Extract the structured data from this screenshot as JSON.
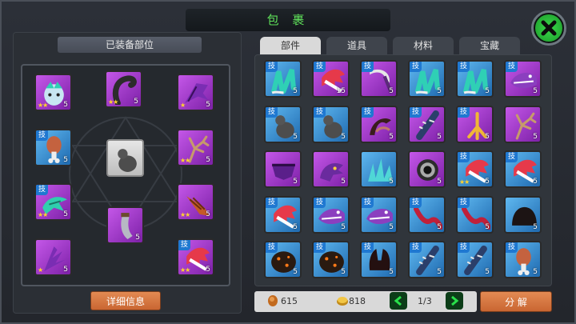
{
  "window": {
    "title": "包 裹"
  },
  "left": {
    "header": "已装备部位",
    "detail_button": "详细信息"
  },
  "tabs": [
    {
      "label": "部件",
      "active": true
    },
    {
      "label": "道具",
      "active": false
    },
    {
      "label": "材料",
      "active": false
    },
    {
      "label": "宝藏",
      "active": false
    }
  ],
  "equipped": [
    {
      "icon": "beast-head-icon",
      "color": "purple",
      "stars": 2,
      "count": "5",
      "tag": ""
    },
    {
      "icon": "scorpion-tail-icon",
      "color": "purple",
      "stars": 2,
      "count": "5",
      "tag": ""
    },
    {
      "icon": "bat-wing-icon",
      "color": "purple",
      "stars": 1,
      "count": "5",
      "tag": ""
    },
    {
      "icon": "meat-leg-icon",
      "color": "blue",
      "stars": 0,
      "count": "5",
      "tag": "技"
    },
    {
      "icon": "gourd-icon",
      "color": "gray",
      "stars": 0,
      "count": "",
      "tag": ""
    },
    {
      "icon": "antler-icon",
      "color": "purple",
      "stars": 2,
      "count": "5",
      "tag": ""
    },
    {
      "icon": "fish-fin-icon",
      "color": "purple",
      "stars": 2,
      "count": "5",
      "tag": "技"
    },
    {
      "icon": "drill-horn-icon",
      "color": "purple",
      "stars": 2,
      "count": "5",
      "tag": ""
    },
    {
      "icon": "curved-blade-icon",
      "color": "purple",
      "stars": 0,
      "count": "5",
      "tag": ""
    },
    {
      "icon": "feather-wing-icon",
      "color": "purple",
      "stars": 1,
      "count": "5",
      "tag": ""
    },
    {
      "icon": "red-claw-icon",
      "color": "purple",
      "stars": 2,
      "count": "5",
      "tag": "技"
    }
  ],
  "grid": [
    {
      "icon": "green-claws-icon",
      "color": "blue",
      "tag": "技",
      "count": "5",
      "stars": 0
    },
    {
      "icon": "red-claw-icon",
      "color": "purple",
      "tag": "技",
      "count": "15",
      "stars": 0
    },
    {
      "icon": "scythe-icon",
      "color": "purple",
      "tag": "技",
      "count": "5",
      "stars": 0
    },
    {
      "icon": "green-claws-icon",
      "color": "blue",
      "tag": "技",
      "count": "5",
      "stars": 0
    },
    {
      "icon": "green-claws-icon",
      "color": "blue",
      "tag": "技",
      "count": "5",
      "stars": 0
    },
    {
      "icon": "shark-head-icon",
      "color": "purple",
      "tag": "技",
      "count": "5",
      "stars": 0
    },
    {
      "icon": "gourd-icon",
      "color": "blue",
      "tag": "技",
      "count": "5",
      "stars": 0
    },
    {
      "icon": "gourd-icon",
      "color": "blue",
      "tag": "技",
      "count": "5",
      "stars": 0
    },
    {
      "icon": "pincer-icon",
      "color": "purple",
      "tag": "技",
      "count": "5",
      "stars": 0
    },
    {
      "icon": "spiked-club-icon",
      "color": "purple",
      "tag": "技",
      "count": "5",
      "stars": 0
    },
    {
      "icon": "bird-foot-icon",
      "color": "purple",
      "tag": "技",
      "count": "5",
      "stars": 0
    },
    {
      "icon": "antler-icon",
      "color": "purple",
      "tag": "",
      "count": "5",
      "stars": 0
    },
    {
      "icon": "armor-plate-icon",
      "color": "purple",
      "tag": "",
      "count": "5",
      "stars": 0
    },
    {
      "icon": "dragon-head-icon",
      "color": "purple",
      "tag": "",
      "count": "5",
      "stars": 0
    },
    {
      "icon": "ice-crystal-icon",
      "color": "blue",
      "tag": "",
      "count": "5",
      "stars": 0
    },
    {
      "icon": "eye-icon",
      "color": "purple",
      "tag": "",
      "count": "5",
      "stars": 0
    },
    {
      "icon": "red-claw-icon",
      "color": "blue",
      "tag": "技",
      "count": "5",
      "stars": 2
    },
    {
      "icon": "red-claw-icon",
      "color": "blue",
      "tag": "技",
      "count": "5",
      "stars": 0
    },
    {
      "icon": "red-claw-icon",
      "color": "blue",
      "tag": "技",
      "count": "5",
      "stars": 0
    },
    {
      "icon": "shark-head-icon",
      "color": "blue",
      "tag": "技",
      "count": "5",
      "stars": 0
    },
    {
      "icon": "shark-head-icon",
      "color": "blue",
      "tag": "技",
      "count": "5",
      "stars": 0
    },
    {
      "icon": "red-tail-icon",
      "color": "blue",
      "tag": "技",
      "count": "5",
      "stars": 0
    },
    {
      "icon": "red-tail-icon",
      "color": "blue",
      "tag": "技",
      "count": "5",
      "stars": 0
    },
    {
      "icon": "dark-blob-icon",
      "color": "blue",
      "tag": "",
      "count": "5",
      "stars": 0
    },
    {
      "icon": "lava-rock-icon",
      "color": "blue",
      "tag": "技",
      "count": "5",
      "stars": 0
    },
    {
      "icon": "lava-rock-icon",
      "color": "blue",
      "tag": "技",
      "count": "5",
      "stars": 0
    },
    {
      "icon": "dark-horns-icon",
      "color": "blue",
      "tag": "技",
      "count": "5",
      "stars": 0
    },
    {
      "icon": "spiked-club-icon",
      "color": "blue",
      "tag": "技",
      "count": "5",
      "stars": 0
    },
    {
      "icon": "spiked-club-icon",
      "color": "blue",
      "tag": "技",
      "count": "5",
      "stars": 0
    },
    {
      "icon": "meat-leg-icon",
      "color": "blue",
      "tag": "技",
      "count": "5",
      "stars": 0
    }
  ],
  "footer": {
    "currency1": "615",
    "currency2": "818",
    "page": "1/3",
    "decompose_button": "分 解"
  }
}
